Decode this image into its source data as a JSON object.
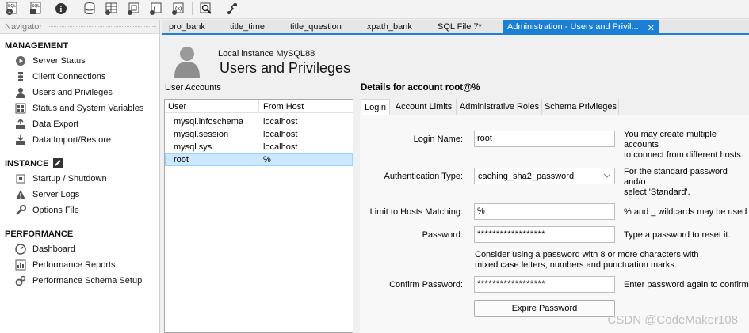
{
  "navigator": {
    "title": "Navigator",
    "sections": {
      "management": "MANAGEMENT",
      "instance": "INSTANCE",
      "performance": "PERFORMANCE"
    },
    "management_items": [
      {
        "label": "Server Status",
        "icon": "server-status-icon"
      },
      {
        "label": "Client Connections",
        "icon": "client-connections-icon"
      },
      {
        "label": "Users and Privileges",
        "icon": "users-icon"
      },
      {
        "label": "Status and System Variables",
        "icon": "variables-icon"
      },
      {
        "label": "Data Export",
        "icon": "data-export-icon"
      },
      {
        "label": "Data Import/Restore",
        "icon": "data-import-icon"
      }
    ],
    "instance_items": [
      {
        "label": "Startup / Shutdown",
        "icon": "startup-icon"
      },
      {
        "label": "Server Logs",
        "icon": "warning-icon"
      },
      {
        "label": "Options File",
        "icon": "wrench-icon"
      }
    ],
    "performance_items": [
      {
        "label": "Dashboard",
        "icon": "dashboard-icon"
      },
      {
        "label": "Performance Reports",
        "icon": "reports-icon"
      },
      {
        "label": "Performance Schema Setup",
        "icon": "schema-setup-icon"
      }
    ]
  },
  "tabs": [
    "pro_bank",
    "title_time",
    "title_question",
    "xpath_bank",
    "SQL File 7*",
    "Administration - Users and Privil..."
  ],
  "header": {
    "instance": "Local instance MySQL88",
    "title": "Users and Privileges"
  },
  "accounts": {
    "label": "User Accounts",
    "columns": [
      "User",
      "From Host"
    ],
    "rows": [
      {
        "user": "mysql.infoschema",
        "host": "localhost"
      },
      {
        "user": "mysql.session",
        "host": "localhost"
      },
      {
        "user": "mysql.sys",
        "host": "localhost"
      },
      {
        "user": "root",
        "host": "%"
      }
    ],
    "selected_index": 3
  },
  "details": {
    "title": "Details for account root@%",
    "tabs": [
      "Login",
      "Account Limits",
      "Administrative Roles",
      "Schema Privileges"
    ],
    "active_tab": "Login",
    "login_name_label": "Login Name:",
    "login_name_value": "root",
    "login_name_help": "You may create multiple accounts\nto connect from different hosts.",
    "auth_type_label": "Authentication Type:",
    "auth_type_value": "caching_sha2_password",
    "auth_type_help": "For the standard password and/o\nselect 'Standard'.",
    "limit_hosts_label": "Limit to Hosts Matching:",
    "limit_hosts_value": "%",
    "limit_hosts_help": "% and _ wildcards may be used",
    "password_label": "Password:",
    "password_value": "******************",
    "password_help": "Type a password to reset it.",
    "password_hint": "Consider using a password with 8 or more characters with\nmixed case letters, numbers and punctuation marks.",
    "confirm_label": "Confirm Password:",
    "confirm_value": "******************",
    "confirm_help": "Enter password again to confirm.",
    "expire_button": "Expire Password"
  },
  "watermark": "CSDN @CodeMaker108",
  "colors": {
    "accent": "#1c7fd6",
    "selection": "#cce8ff"
  }
}
